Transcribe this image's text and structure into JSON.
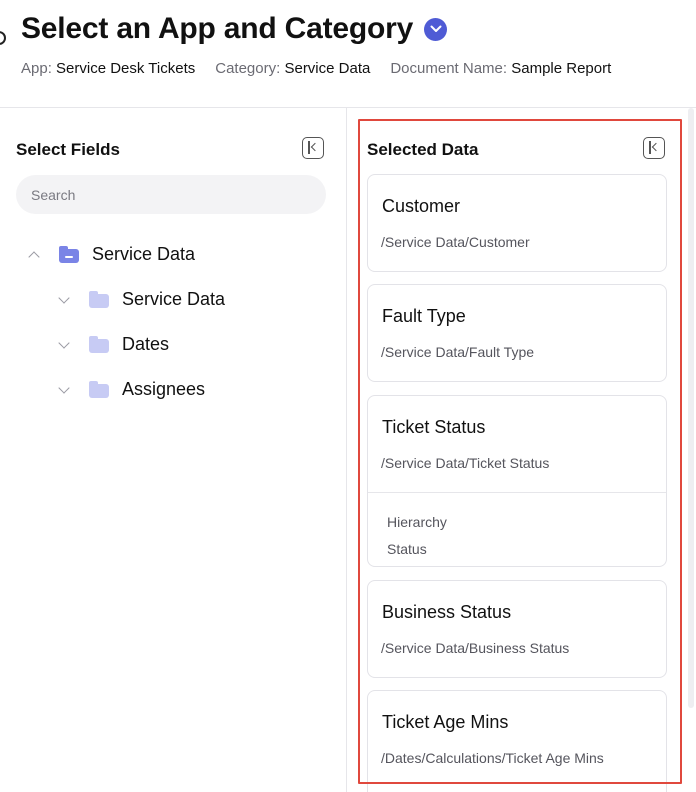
{
  "header": {
    "title": "Select an App and Category",
    "meta": [
      {
        "label": "App:",
        "value": "Service Desk Tickets"
      },
      {
        "label": "Category:",
        "value": "Service Data"
      },
      {
        "label": "Document Name:",
        "value": "Sample Report"
      }
    ]
  },
  "left_panel": {
    "title": "Select Fields",
    "search_placeholder": "Search",
    "tree": [
      {
        "label": "Service Data",
        "expanded": true,
        "icon": "folder-open-icon"
      },
      {
        "label": "Service Data",
        "expanded": false,
        "icon": "folder-icon"
      },
      {
        "label": "Dates",
        "expanded": false,
        "icon": "folder-icon"
      },
      {
        "label": "Assignees",
        "expanded": false,
        "icon": "folder-icon"
      }
    ]
  },
  "right_panel": {
    "title": "Selected Data",
    "cards": [
      {
        "title": "Customer",
        "path": "/Service Data/Customer"
      },
      {
        "title": "Fault Type",
        "path": "/Service Data/Fault Type"
      },
      {
        "title": "Ticket Status",
        "path": "/Service Data/Ticket Status",
        "sub_items": [
          "Hierarchy",
          "Status"
        ]
      },
      {
        "title": "Business Status",
        "path": "/Service Data/Business Status"
      },
      {
        "title": "Ticket Age Mins",
        "path": "/Dates/Calculations/Ticket Age Mins"
      }
    ]
  },
  "colors": {
    "accent": "#4f5bd5",
    "folder_open": "#7a84e6",
    "folder_closed": "#c7cbf4",
    "highlight": "#e0483d"
  }
}
